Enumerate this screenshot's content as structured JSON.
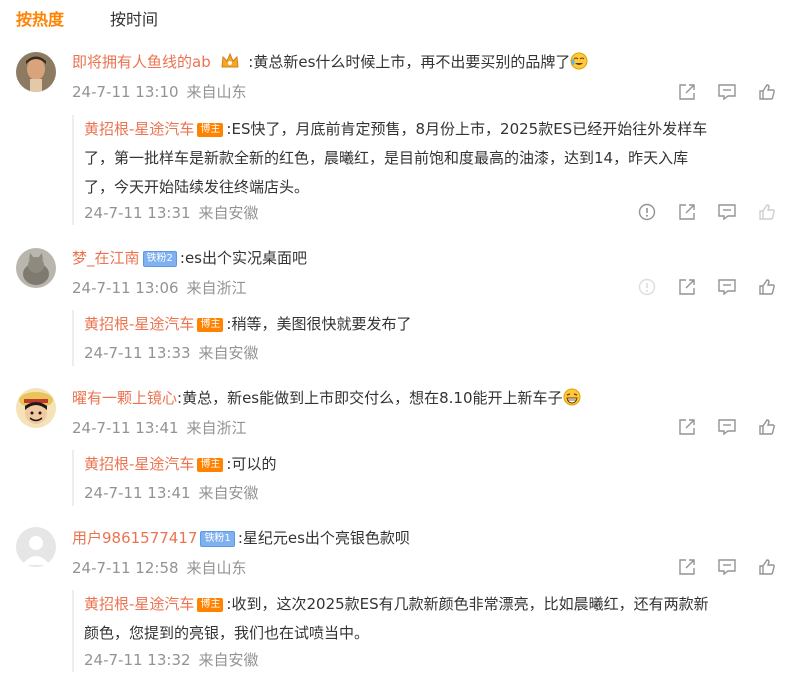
{
  "tabs": {
    "hot": "按热度",
    "time": "按时间"
  },
  "colors": {
    "accent": "#ff8200",
    "username": "#eb7350",
    "meta": "#939393"
  },
  "icons": [
    "share-icon",
    "comment-icon",
    "like-icon",
    "report-icon"
  ],
  "comments": [
    {
      "user": "即将拥有人鱼线的ab",
      "text": ":黄总新es什么时候上市，再不出要买别的品牌了",
      "time": "24-7-11 13:10",
      "source": "来自山东",
      "reply": {
        "user": "黄招根-星途汽车",
        "badge": "博主",
        "lines": [
          ":ES快了，月底前肯定预售，8月份上市，2025款ES已经开始往外发样车",
          "了，第一批样车是新款全新的红色，晨曦红，是目前饱和度最高的油漆，达到14，昨天入库",
          "了，今天开始陆续发往终端店头。"
        ],
        "time": "24-7-11 13:31",
        "source": "来自安徽"
      }
    },
    {
      "user": "梦_在江南",
      "badge": "铁粉2",
      "text": ":es出个实况桌面吧",
      "time": "24-7-11 13:06",
      "source": "来自浙江",
      "reply": {
        "user": "黄招根-星途汽车",
        "badge": "博主",
        "lines": [
          ":稍等，美图很快就要发布了"
        ],
        "time": "24-7-11 13:33",
        "source": "来自安徽"
      }
    },
    {
      "user": "曜有一颗上镜心",
      "text": ":黄总，新es能做到上市即交付么，想在8.10能开上新车子",
      "time": "24-7-11 13:41",
      "source": "来自浙江",
      "reply": {
        "user": "黄招根-星途汽车",
        "badge": "博主",
        "lines": [
          ":可以的"
        ],
        "time": "24-7-11 13:41",
        "source": "来自安徽"
      }
    },
    {
      "user": "用户9861577417",
      "badge": "铁粉1",
      "text": ":星纪元es出个亮银色款呗",
      "time": "24-7-11 12:58",
      "source": "来自山东",
      "reply": {
        "user": "黄招根-星途汽车",
        "badge": "博主",
        "lines": [
          ":收到，这次2025款ES有几款新颜色非常漂亮，比如晨曦红，还有两款新",
          "颜色，您提到的亮银，我们也在试喷当中。"
        ],
        "time": "24-7-11 13:32",
        "source": "来自安徽"
      }
    }
  ]
}
